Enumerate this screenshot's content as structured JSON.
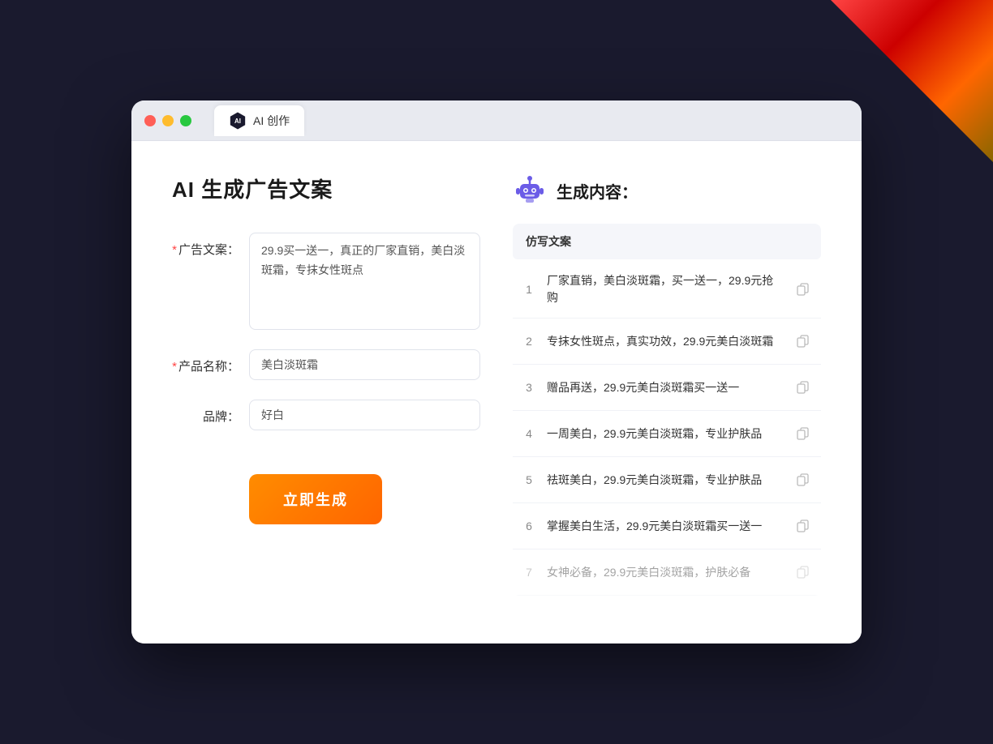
{
  "browser": {
    "tab_label": "AI 创作"
  },
  "left": {
    "title": "AI 生成广告文案",
    "fields": [
      {
        "id": "ad_copy",
        "label": "广告文案：",
        "required": true,
        "type": "textarea",
        "value": "29.9买一送一，真正的厂家直销，美白淡斑霜，专抹女性斑点"
      },
      {
        "id": "product_name",
        "label": "产品名称：",
        "required": true,
        "type": "text",
        "value": "美白淡斑霜"
      },
      {
        "id": "brand",
        "label": "品牌：",
        "required": false,
        "type": "text",
        "value": "好白"
      }
    ],
    "submit_label": "立即生成"
  },
  "right": {
    "title": "生成内容：",
    "table_header": "仿写文案",
    "results": [
      {
        "num": "1",
        "text": "厂家直销，美白淡斑霜，买一送一，29.9元抢购"
      },
      {
        "num": "2",
        "text": "专抹女性斑点，真实功效，29.9元美白淡斑霜"
      },
      {
        "num": "3",
        "text": "赠品再送，29.9元美白淡斑霜买一送一"
      },
      {
        "num": "4",
        "text": "一周美白，29.9元美白淡斑霜，专业护肤品"
      },
      {
        "num": "5",
        "text": "祛斑美白，29.9元美白淡斑霜，专业护肤品"
      },
      {
        "num": "6",
        "text": "掌握美白生活，29.9元美白淡斑霜买一送一"
      },
      {
        "num": "7",
        "text": "女神必备，29.9元美白淡斑霜，护肤必备"
      }
    ]
  }
}
